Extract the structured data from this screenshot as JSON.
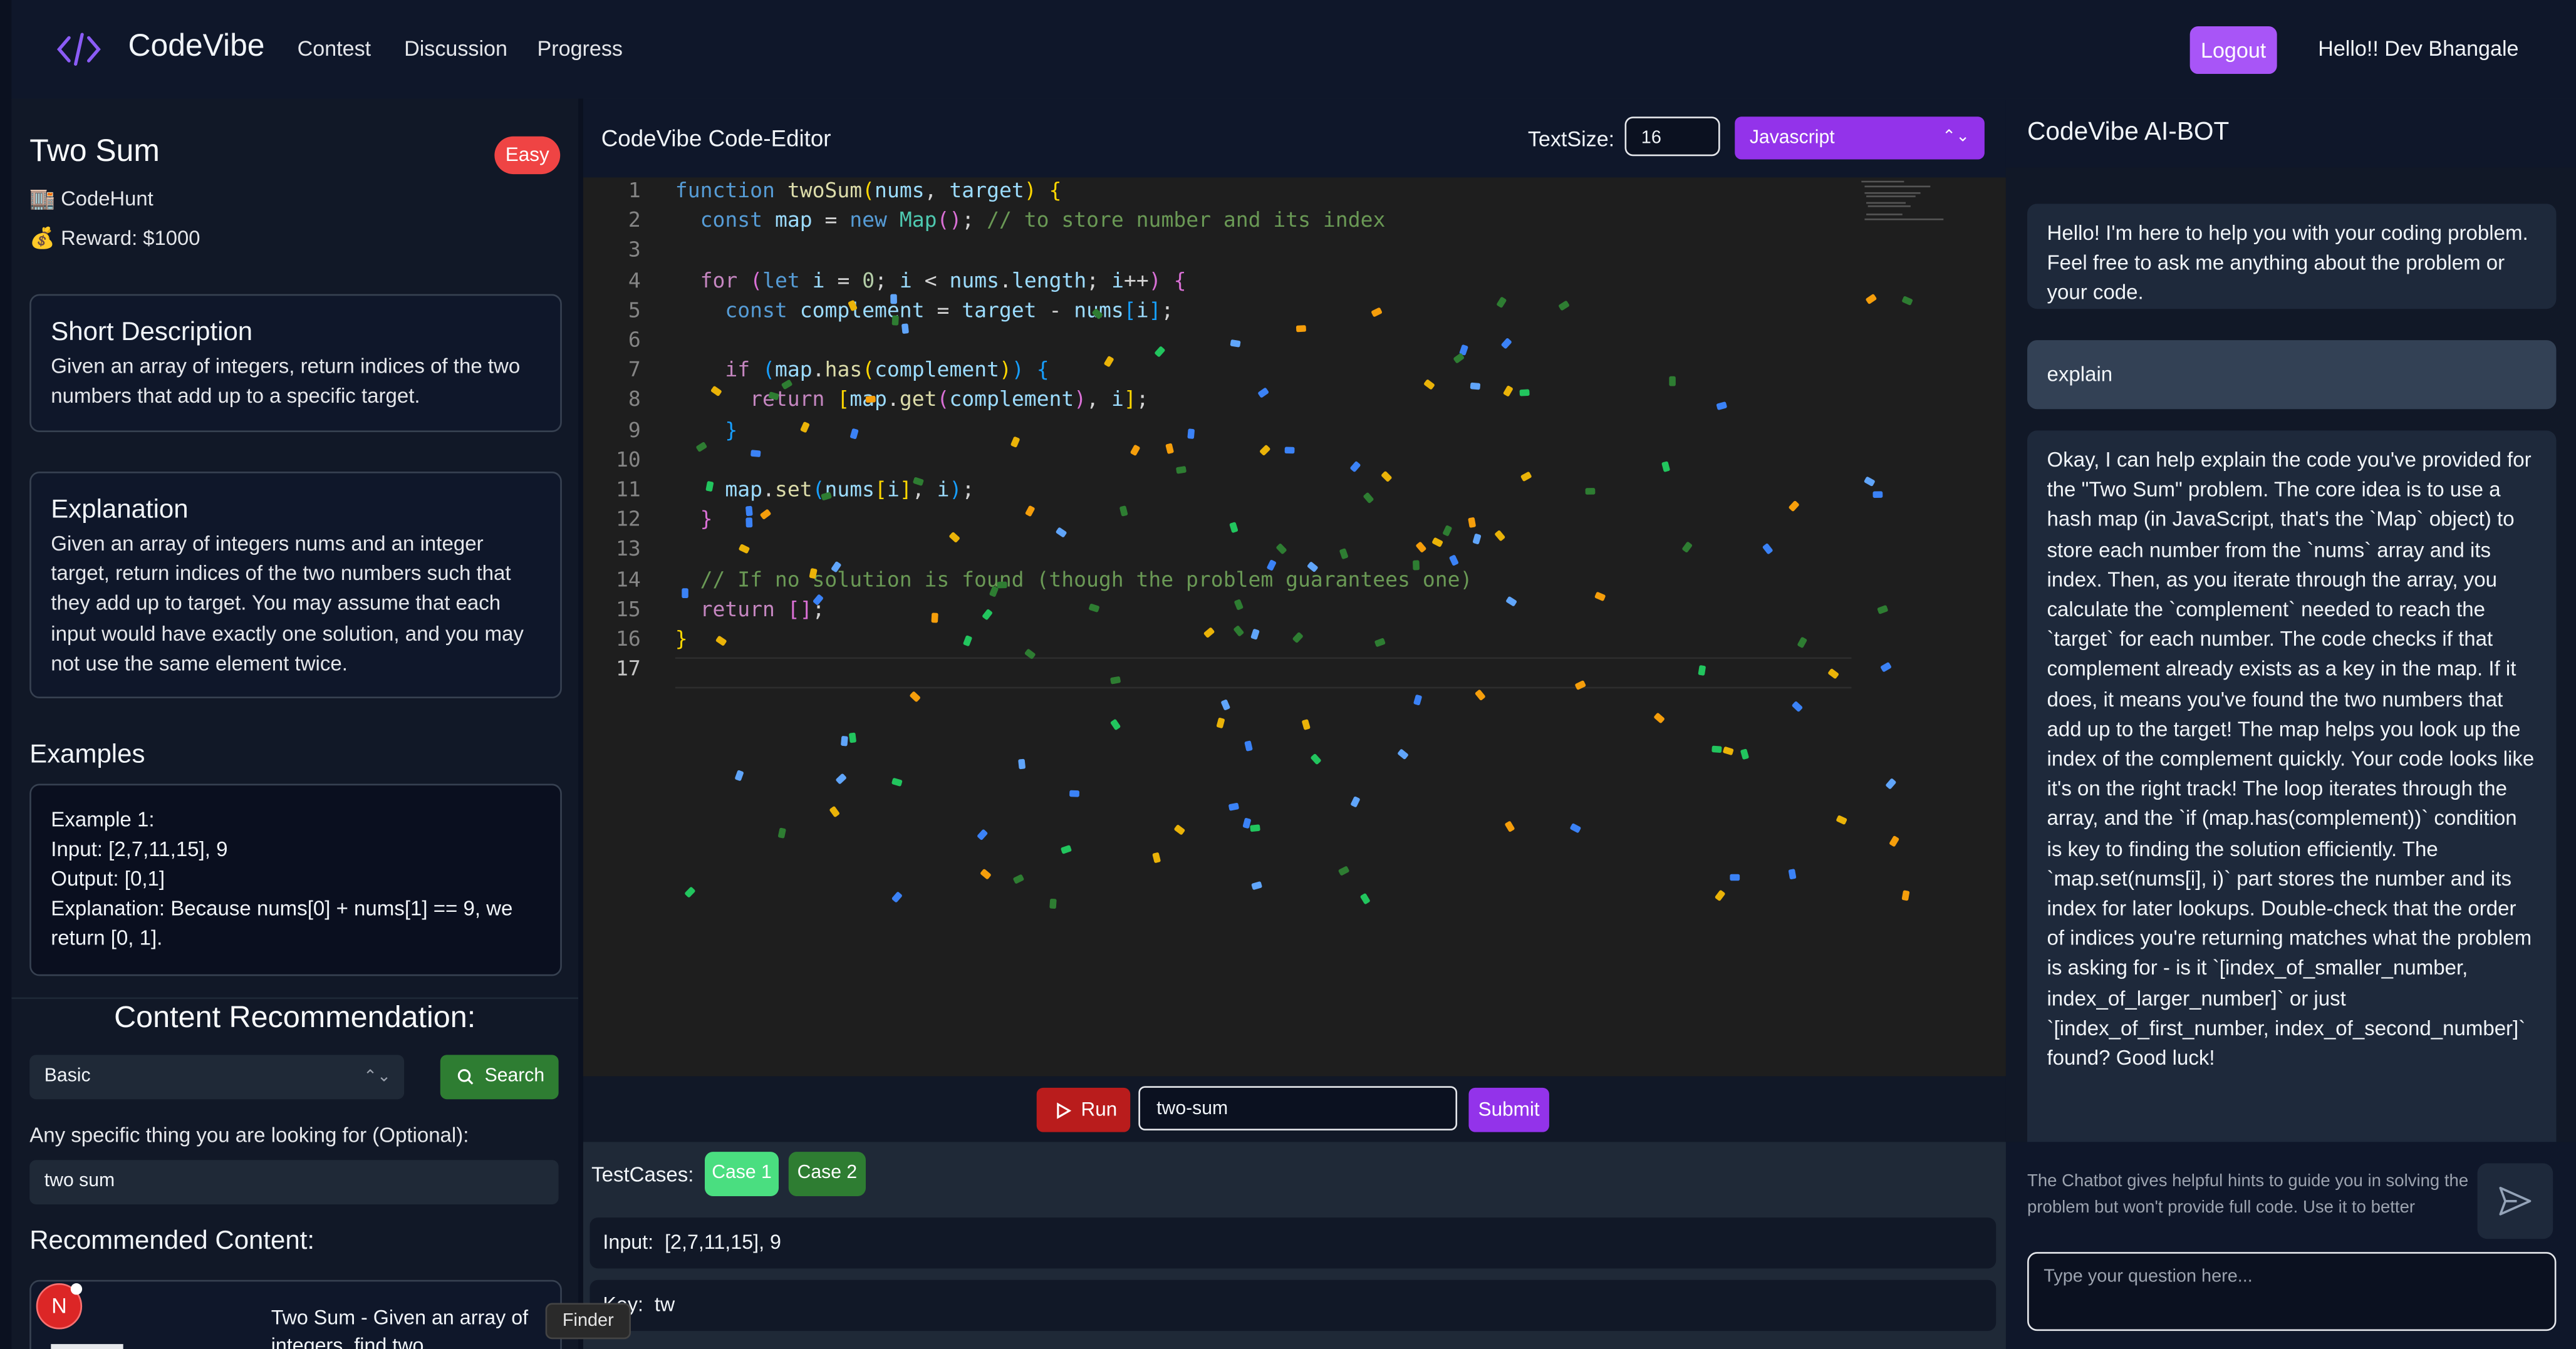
{
  "nav": {
    "brand": "CodeVibe",
    "links": [
      "Contest",
      "Discussion",
      "Progress"
    ],
    "logout_label": "Logout",
    "greeting": "Hello!! Dev Bhangale",
    "brand_color": "#8b5cf6"
  },
  "problem": {
    "title": "Two Sum",
    "difficulty": "Easy",
    "company": "🏬 CodeHunt",
    "reward": "💰 Reward: $1000",
    "short_description_heading": "Short Description",
    "short_description": "Given an array of integers, return indices of the two numbers that add up to a specific target.",
    "explanation_heading": "Explanation",
    "explanation": "Given an array of integers nums and an integer target, return indices of the two numbers such that they add up to target. You may assume that each input would have exactly one solution, and you may not use the same element twice.",
    "examples_heading": "Examples",
    "example": {
      "label": "Example 1:",
      "input": "Input: [2,7,11,15], 9",
      "output": "Output: [0,1]",
      "explanation": "Explanation: Because nums[0] + nums[1] == 9, we return [0, 1]."
    }
  },
  "recommendation": {
    "heading": "Content Recommendation:",
    "level": "Basic",
    "search_label": "Search",
    "optional_label": "Any specific thing you are looking for (Optional):",
    "query": "two sum",
    "recommended_heading": "Recommended Content:",
    "item_text": "Two Sum - Given an array of integers, find two"
  },
  "avatar_letter": "N",
  "tooltip": "Finder",
  "editor": {
    "title": "CodeVibe Code-Editor",
    "textsize_label": "TextSize:",
    "textsize_value": "16",
    "language": "Javascript",
    "line_numbers": [
      "1",
      "2",
      "3",
      "4",
      "5",
      "6",
      "7",
      "8",
      "9",
      "10",
      "11",
      "12",
      "13",
      "14",
      "15",
      "16",
      "17"
    ],
    "run_label": "Run",
    "slug": "two-sum",
    "submit_label": "Submit"
  },
  "tests": {
    "label": "TestCases:",
    "cases": [
      "Case 1",
      "Case 2"
    ],
    "input_label": "Input:",
    "input_value": "[2,7,11,15], 9",
    "key_label": "Key:",
    "key_value": "tw"
  },
  "chat": {
    "title": "CodeVibe AI-BOT",
    "messages": [
      "Hello! I'm here to help you with your coding problem. Feel free to ask me anything about the problem or your code.",
      "explain",
      "Okay, I can help explain the code you've provided for the \"Two Sum\" problem. The core idea is to use a hash map (in JavaScript, that's the `Map` object) to store each number from the `nums` array and its index. Then, as you iterate through the array, you calculate the `complement` needed to reach the `target` for each number. The code checks if that complement already exists as a key in the map. If it does, it means you've found the two numbers that add up to the target! The map helps you look up the index of the complement quickly. Your code looks like it's on the right track! The loop iterates through the array, and the `if (map.has(complement))` condition is key to finding the solution efficiently. The `map.set(nums[i], i)` part stores the number and its index for later lookups. Double-check that the order of indices you're returning matches what the problem is asking for - is it `[index_of_smaller_number, index_of_larger_number]` or just `[index_of_first_number, index_of_second_number]` found? Good luck!"
    ],
    "hint": "The Chatbot gives helpful hints to guide you in solving the problem but won't provide full code. Use it to better understand and approach the problem.",
    "placeholder": "Type your question here..."
  }
}
